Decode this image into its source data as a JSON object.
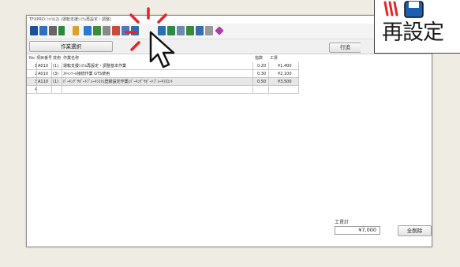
{
  "window": {
    "title": "TFXPRO:ﾌｧｲﾙ(2)  (運転支援ｼｽﾃﾑ再設定・調整)"
  },
  "toolbar": {
    "icons": [
      "save-icon",
      "save-as-icon",
      "print-icon",
      "export-icon",
      "search-icon",
      "calendar-icon",
      "book-icon",
      "chart-icon",
      "person-icon",
      "list-icon",
      "table-icon",
      "settings-icon",
      "tools-icon",
      "gear-icon",
      "grid-icon",
      "mail-icon",
      "car-icon",
      "diamond-icon"
    ]
  },
  "buttons": {
    "work_select": "作業選択",
    "row_insert": "行追",
    "delete_all": "全削除"
  },
  "grid": {
    "columns": {
      "no": "No",
      "item_no": "項目番号",
      "tech": "技術",
      "name": "作業名称",
      "index": "指数",
      "wage": "工賃"
    },
    "rows": [
      {
        "no": "1",
        "item_no": "A010",
        "tech": "(1)",
        "name": "運転支援ｼｽﾃﾑ再設定・調整基本作業",
        "index": "0.20",
        "wage": "¥1,400"
      },
      {
        "no": "2",
        "item_no": "A010",
        "tech": "(3)",
        "name": "ｽｷｬﾝﾂｰﾙ接続作業 GTS使用",
        "index": "0.30",
        "wage": "¥2,100"
      },
      {
        "no": "3",
        "item_no": "A110",
        "tech": "(1)",
        "name": "ﾊﾟｰｷﾝｸﾞｻﾎﾟｰﾄﾌﾞﾚｰｷｼｽﾃﾑ登録設定作業(ﾊﾟｰｷﾝｸﾞｻﾎﾟｰﾄﾌﾞﾚｰｷ)ﾌﾛﾝﾄ",
        "index": "0.50",
        "wage": "¥3,500"
      },
      {
        "no": "4",
        "item_no": "",
        "tech": "",
        "name": "",
        "index": "",
        "wage": ""
      }
    ]
  },
  "totals": {
    "label": "工賃計",
    "value": "¥7,000"
  },
  "overlay": {
    "label": "再設定"
  },
  "colors": {
    "accent_red": "#e8242a",
    "icon_blue": "#1c5fb0"
  }
}
